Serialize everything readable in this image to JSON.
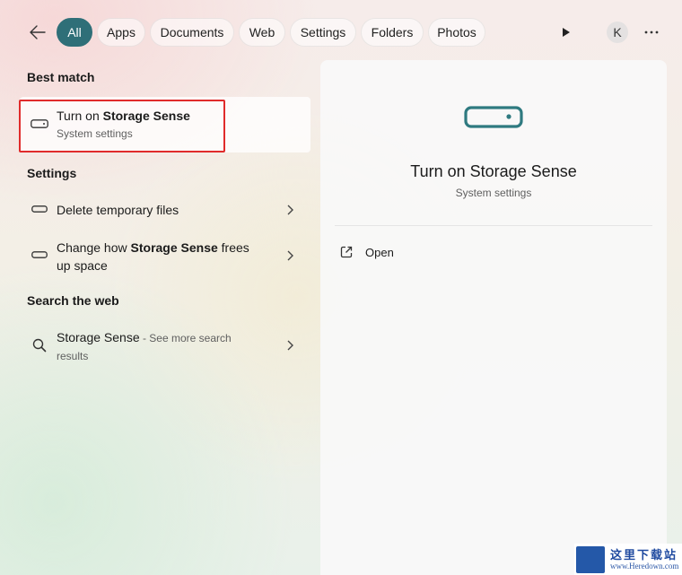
{
  "filters": [
    {
      "label": "All",
      "active": true
    },
    {
      "label": "Apps"
    },
    {
      "label": "Documents"
    },
    {
      "label": "Web"
    },
    {
      "label": "Settings"
    },
    {
      "label": "Folders"
    },
    {
      "label": "Photos"
    }
  ],
  "account": {
    "initial": "K"
  },
  "best_match": {
    "heading": "Best match",
    "title_prefix": "Turn on ",
    "title_bold": "Storage Sense",
    "subtitle": "System settings"
  },
  "settings": {
    "heading": "Settings",
    "items": [
      {
        "text": "Delete temporary files"
      },
      {
        "prefix": "Change how ",
        "bold": "Storage Sense",
        "suffix": " frees",
        "line2": "up space"
      }
    ]
  },
  "web": {
    "heading": "Search the web",
    "query": "Storage Sense",
    "hint": " - See more search",
    "hint_line2": "results"
  },
  "detail": {
    "title": "Turn on Storage Sense",
    "subtitle": "System settings",
    "action_open": "Open"
  },
  "watermark": {
    "cn": "这里下载站",
    "en": "www.Heredown.com"
  },
  "colors": {
    "accent": "#2f6f78",
    "highlight": "#e02b2b"
  }
}
